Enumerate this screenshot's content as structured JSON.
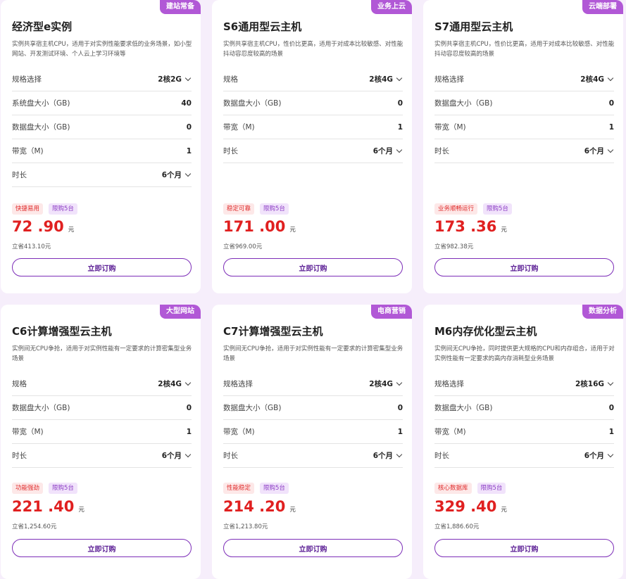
{
  "cards": [
    {
      "badge": "建站常备",
      "title": "经济型e实例",
      "desc": "实例共享宿主机CPU，适用于对实例性能要求低的业务场景，如小型网站、开发测试环境、个人云上学习环境等",
      "rows": [
        {
          "label": "规格选择",
          "value": "2核2G",
          "dropdown": true
        },
        {
          "label": "系统盘大小（GB)",
          "value": "40",
          "dropdown": false
        },
        {
          "label": "数据盘大小（GB)",
          "value": "0",
          "dropdown": false
        },
        {
          "label": "带宽（M)",
          "value": "1",
          "dropdown": false
        },
        {
          "label": "时长",
          "value": "6个月",
          "dropdown": true
        }
      ],
      "tag1": "快捷易用",
      "tag2": "限购5台",
      "price": "72 .90",
      "unit": "元",
      "save": "立省413.10元",
      "button": "立即订购"
    },
    {
      "badge": "业务上云",
      "title": "S6通用型云主机",
      "desc": "实例共享宿主机CPU，性价比更高，适用于对成本比较敏感、对性能抖动容忍度较高的场景",
      "rows": [
        {
          "label": "规格",
          "value": "2核4G",
          "dropdown": true
        },
        {
          "label": "数据盘大小（GB)",
          "value": "0",
          "dropdown": false
        },
        {
          "label": "带宽（M)",
          "value": "1",
          "dropdown": false
        },
        {
          "label": "时长",
          "value": "6个月",
          "dropdown": true
        }
      ],
      "tag1": "稳定可靠",
      "tag2": "限购5台",
      "price": "171 .00",
      "unit": "元",
      "save": "立省969.00元",
      "button": "立即订购"
    },
    {
      "badge": "云端部署",
      "title": "S7通用型云主机",
      "desc": "实例共享宿主机CPU，性价比更高，适用于对成本比较敏感、对性能抖动容忍度较高的场景",
      "rows": [
        {
          "label": "规格选择",
          "value": "2核4G",
          "dropdown": true
        },
        {
          "label": "数据盘大小（GB)",
          "value": "0",
          "dropdown": false
        },
        {
          "label": "带宽（M)",
          "value": "1",
          "dropdown": false
        },
        {
          "label": "时长",
          "value": "6个月",
          "dropdown": true
        }
      ],
      "tag1": "业务顺畅运行",
      "tag2": "限购5台",
      "price": "173 .36",
      "unit": "元",
      "save": "立省982.38元",
      "button": "立即订购"
    },
    {
      "badge": "大型网站",
      "title": "C6计算增强型云主机",
      "desc": "实例间无CPU争抢，适用于对实例性能有一定要求的计算密集型业务场景",
      "rows": [
        {
          "label": "规格",
          "value": "2核4G",
          "dropdown": true
        },
        {
          "label": "数据盘大小（GB)",
          "value": "0",
          "dropdown": false
        },
        {
          "label": "带宽（M)",
          "value": "1",
          "dropdown": false
        },
        {
          "label": "时长",
          "value": "6个月",
          "dropdown": true
        }
      ],
      "tag1": "功能强劲",
      "tag2": "限购5台",
      "price": "221 .40",
      "unit": "元",
      "save": "立省1,254.60元",
      "button": "立即订购"
    },
    {
      "badge": "电商营销",
      "title": "C7计算增强型云主机",
      "desc": "实例间无CPU争抢，适用于对实例性能有一定要求的计算密集型业务场景",
      "rows": [
        {
          "label": "规格选择",
          "value": "2核4G",
          "dropdown": true
        },
        {
          "label": "数据盘大小（GB)",
          "value": "0",
          "dropdown": false
        },
        {
          "label": "带宽（M)",
          "value": "1",
          "dropdown": false
        },
        {
          "label": "时长",
          "value": "6个月",
          "dropdown": true
        }
      ],
      "tag1": "性能稳定",
      "tag2": "限购5台",
      "price": "214 .20",
      "unit": "元",
      "save": "立省1,213.80元",
      "button": "立即订购"
    },
    {
      "badge": "数据分析",
      "title": "M6内存优化型云主机",
      "desc": "实例间无CPU争抢，同时提供更大规格的CPU和内存组合，适用于对实例性能有一定要求的高内存消耗型业务场景",
      "rows": [
        {
          "label": "规格选择",
          "value": "2核16G",
          "dropdown": true
        },
        {
          "label": "数据盘大小（GB)",
          "value": "0",
          "dropdown": false
        },
        {
          "label": "带宽（M)",
          "value": "1",
          "dropdown": false
        },
        {
          "label": "时长",
          "value": "6个月",
          "dropdown": true
        }
      ],
      "tag1": "核心数据库",
      "tag2": "限购5台",
      "price": "329 .40",
      "unit": "元",
      "save": "立省1,886.60元",
      "button": "立即订购"
    }
  ]
}
